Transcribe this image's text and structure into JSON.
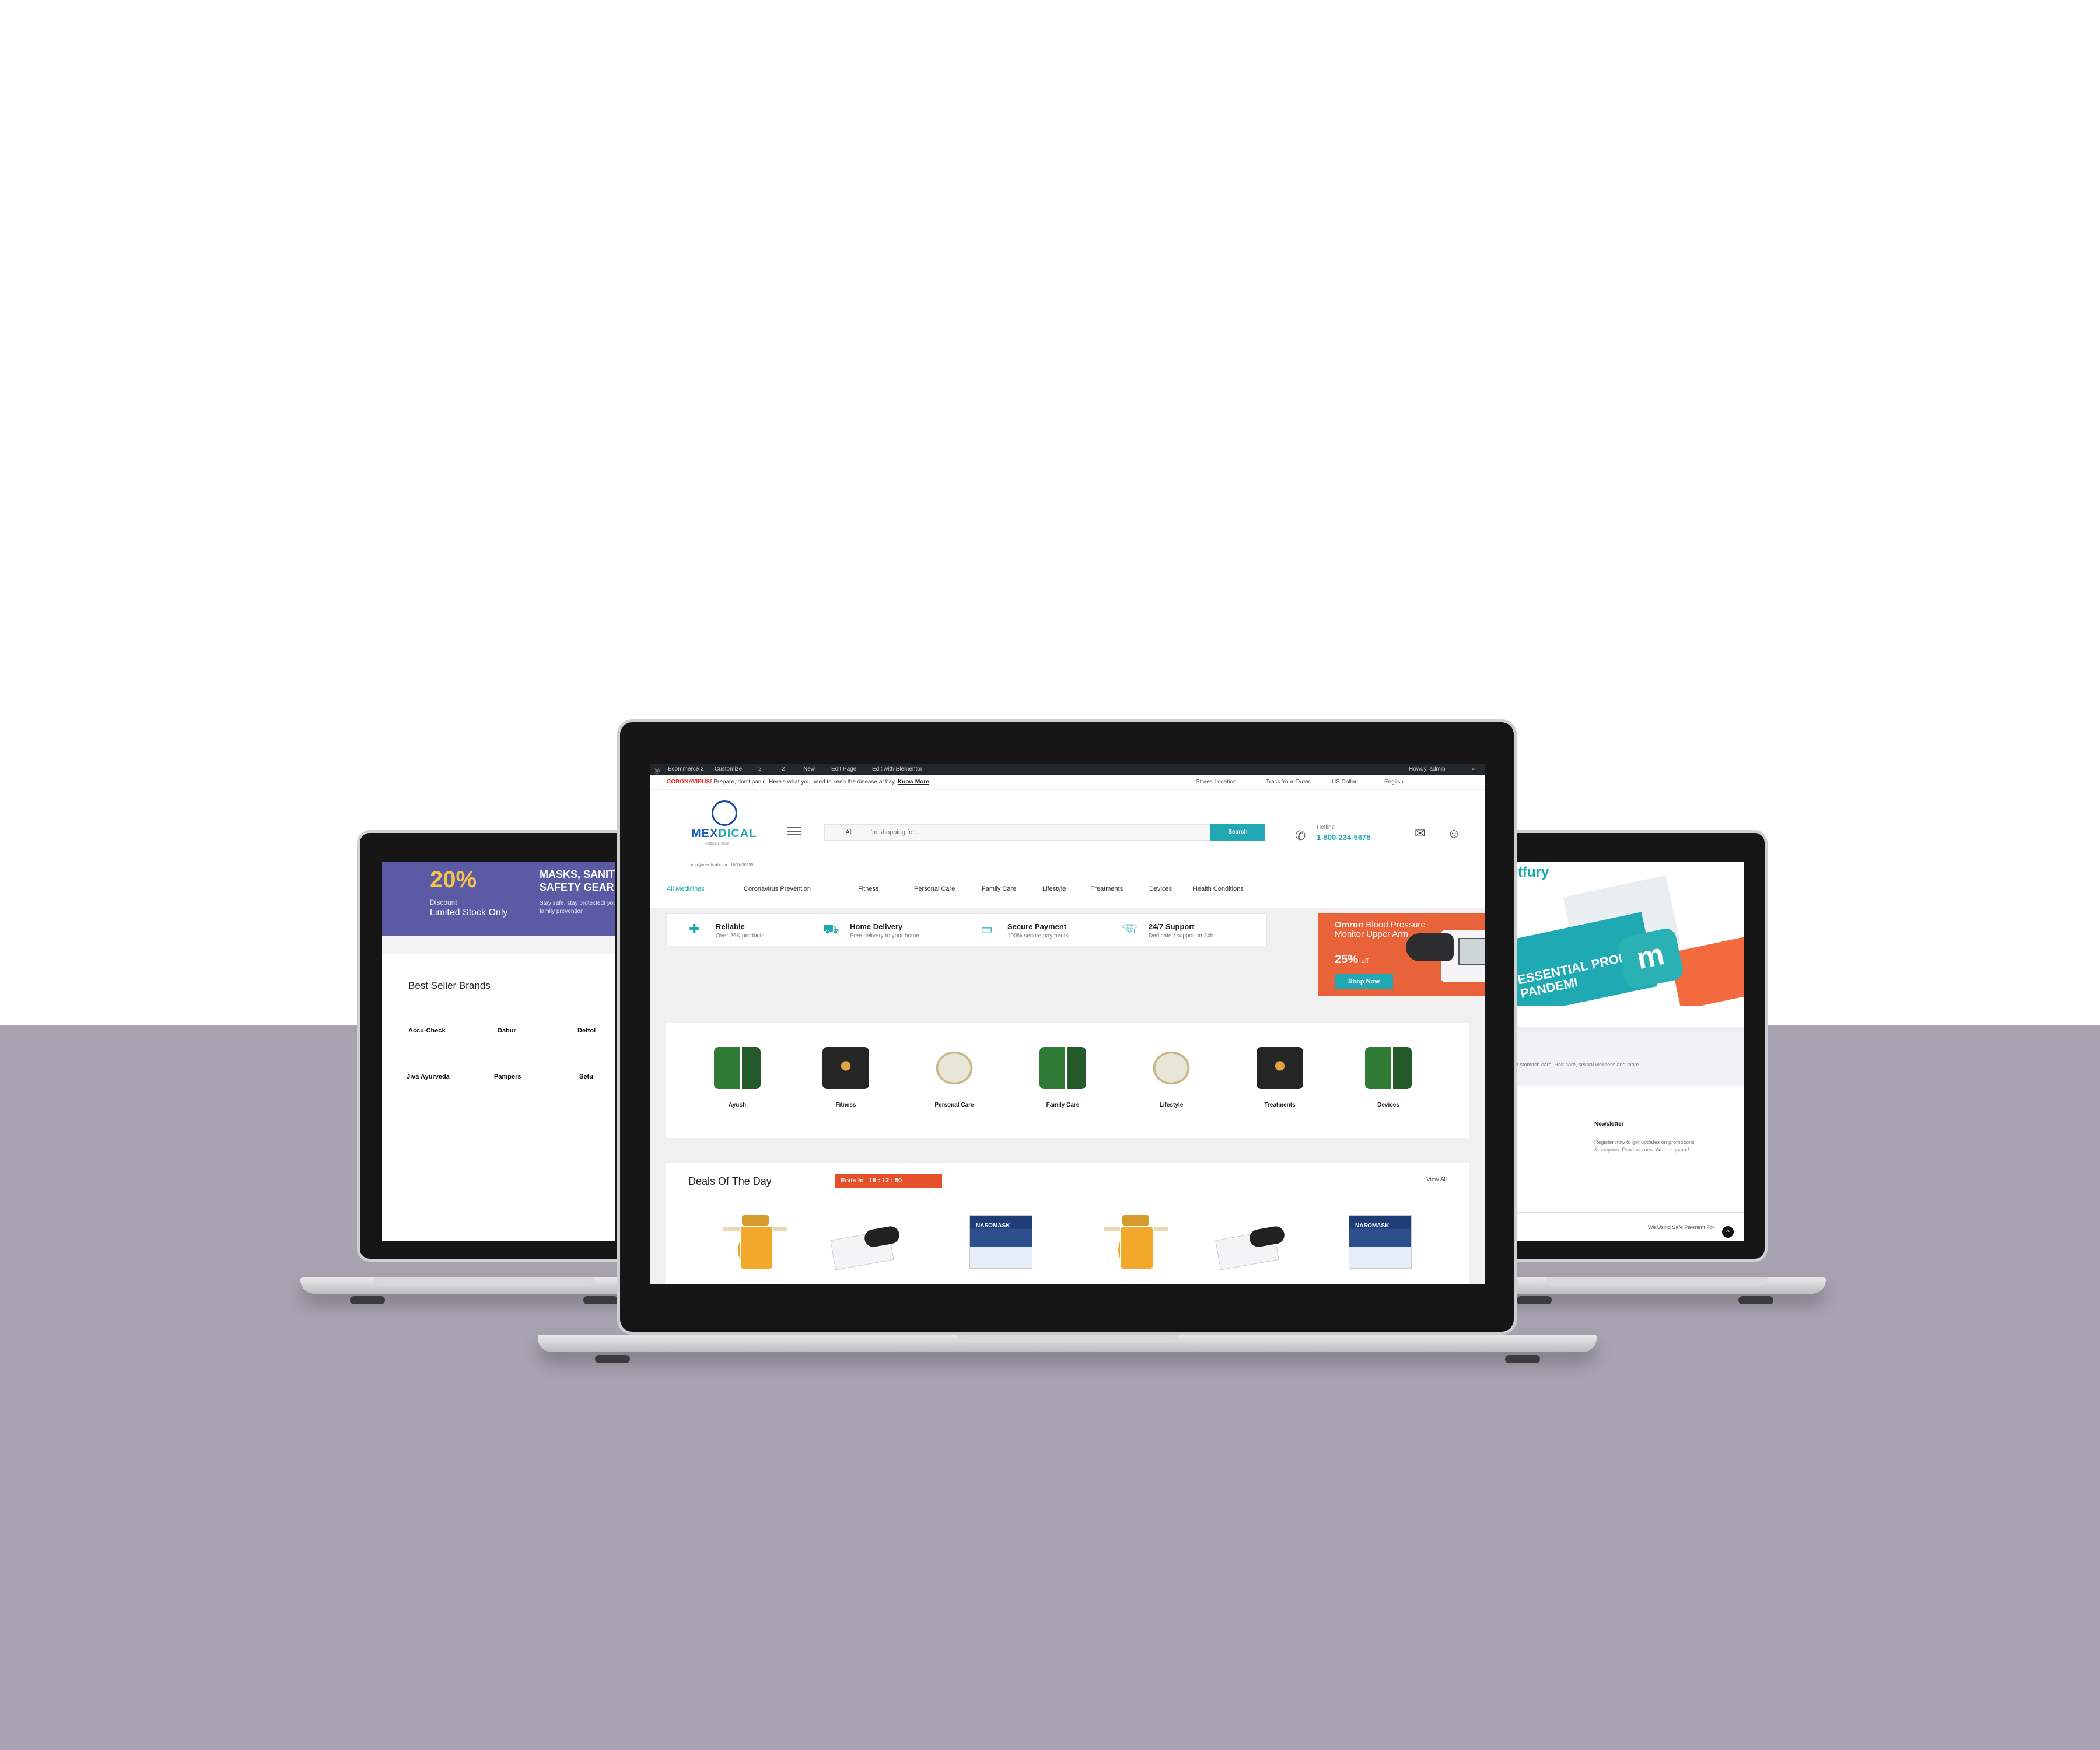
{
  "left_screen": {
    "promo_percent": "20%",
    "promo_discount": "Discount",
    "promo_stock": "Limited Stock Only",
    "promo_title": "MASKS, SANITI SAFETY GEAR",
    "promo_sub": "Stay safe, stay protected! your family prevention",
    "brands_title": "Best Seller Brands",
    "brands": [
      "Accu-Check",
      "Dabur",
      "Dettol",
      "Jiva Ayurveda",
      "Pampers",
      "Setu"
    ]
  },
  "right_screen": {
    "brand_fragment": "tfury",
    "hero_text": "ESSENTIAL PRODUCTS IN THE PANDEMI",
    "hero_logo": "m",
    "band_text": "ed for stomach care, Hair care, sexual wellness and more",
    "newsletter_title": "Newsletter",
    "newsletter_sub": "Register now to get updates on promotions & coupons. Don't worries. We not spam !",
    "footer_text": "We Using Safe Payment For",
    "top_arrow": "^"
  },
  "wpbar": {
    "site": "Ecommerce 2",
    "customize": "Customize",
    "comments": "2",
    "updates": "2",
    "new": "New",
    "edit_page": "Edit Page",
    "elementor": "Edit with Elementor",
    "howdy": "Howdy, admin"
  },
  "topbar": {
    "corona_label": "CORONAVIRUS!",
    "corona_text": " Prepare, don't panic. Here's what you need to keep the disease at bay. ",
    "know_more": "Know More",
    "stores": "Stores Location",
    "track": "Track Your Order",
    "currency": "US Dollar",
    "language": "English"
  },
  "header": {
    "logo_word_a": "MEX",
    "logo_word_b": "DICAL",
    "logo_tag": "Healthcare Store",
    "email_line": "info@mexdical.com · 1800450555",
    "search_cat": "All",
    "search_placeholder": "I'm shopping for...",
    "search_button": "Search",
    "hotline_label": "Hotline",
    "hotline_number": "1-800-234-5678"
  },
  "nav": [
    "All Medicines",
    "Coronavirus Prevention",
    "Fitness",
    "Personal Care",
    "Family Care",
    "Lifestyle",
    "Treatments",
    "Devices",
    "Health Conditions"
  ],
  "features": [
    {
      "title": "Reliable",
      "sub": "Over 26K products"
    },
    {
      "title": "Home Delivery",
      "sub": "Free delivery to your home"
    },
    {
      "title": "Secure Payment",
      "sub": "100% secure payments"
    },
    {
      "title": "24/7 Support",
      "sub": "Dedicated support in 24h"
    }
  ],
  "banner": {
    "brand": "Omron",
    "text": " Blood Pressure Monitor Upper Arm",
    "percent": "25%",
    "off": "off",
    "button": "Shop Now"
  },
  "categories": [
    "Ayush",
    "Fitness",
    "Personal Care",
    "Family Care",
    "Lifestyle",
    "Treatments",
    "Devices"
  ],
  "deals": {
    "title": "Deals Of The Day",
    "ends_label": "Ends In",
    "timer": "18 : 12 : 50",
    "view_all": "View All",
    "mask_label": "NASOMASK"
  },
  "colors": {
    "accent": "#22a8b2",
    "orange": "#e8623a",
    "promo": "#5b5aa5",
    "floor": "#a7a3b1"
  }
}
